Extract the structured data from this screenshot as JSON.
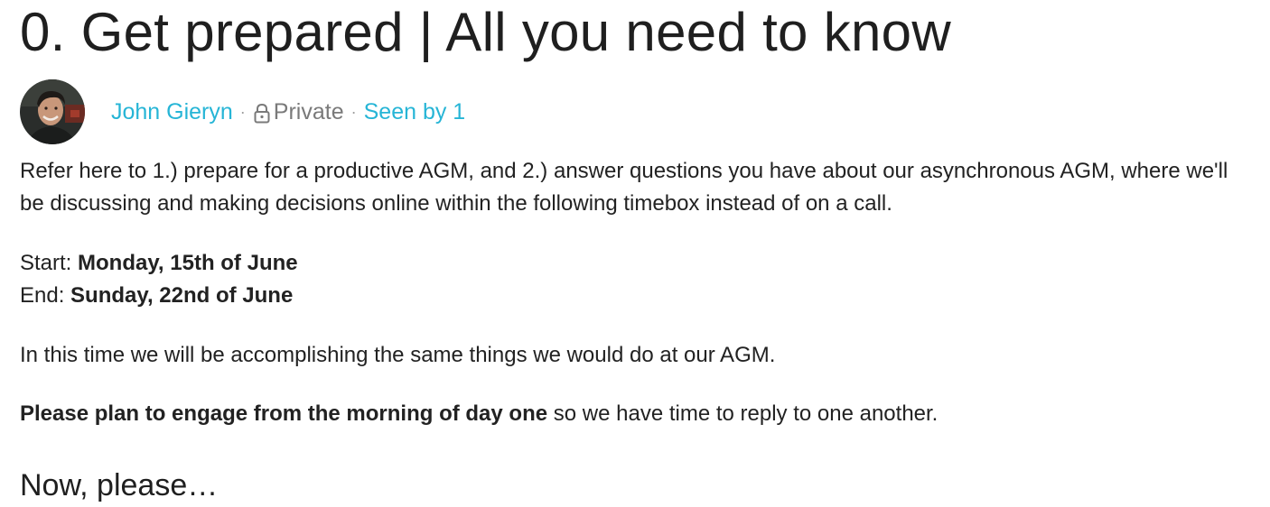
{
  "post": {
    "title": "0. Get prepared | All you need to know",
    "author": "John Gieryn",
    "separator": "·",
    "privacy": "Private",
    "seen_by": "Seen by 1"
  },
  "content": {
    "intro": "Refer here to 1.) prepare for a productive AGM, and 2.) answer questions you have about our asynchronous AGM, where we'll be discussing and making decisions online within the following timebox instead of on a call.",
    "start_label": "Start: ",
    "start_value": "Monday, 15th of June",
    "end_label": "End: ",
    "end_value": "Sunday, 22nd of June",
    "same_things": "In this time we will be accomplishing the same things we would do at our AGM.",
    "engage_bold": "Please plan to engage from the morning of day one",
    "engage_rest": " so we have time to reply to one another.",
    "next_heading": "Now, please…"
  },
  "icons": {
    "avatar": "user-avatar-photo",
    "privacy": "lock-icon"
  },
  "colors": {
    "link": "#26b5d6",
    "muted": "#7a7a7a",
    "text": "#222222"
  }
}
